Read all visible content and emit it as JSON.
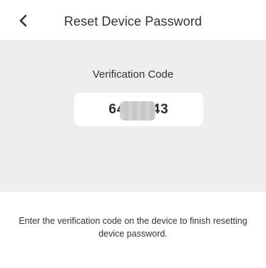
{
  "header": {
    "back_icon": "chevron-left-icon",
    "title": "Reset Device Password"
  },
  "verification": {
    "label": "Verification Code",
    "code_visible_prefix": "64",
    "code_visible_suffix": "43",
    "code_redacted": true
  },
  "instructions": {
    "line1": "Enter the verification code on the device to finish resetting",
    "line2": "device password."
  },
  "colors": {
    "background": "#ffffff",
    "panel": "#eeeeee",
    "text": "#333333"
  }
}
